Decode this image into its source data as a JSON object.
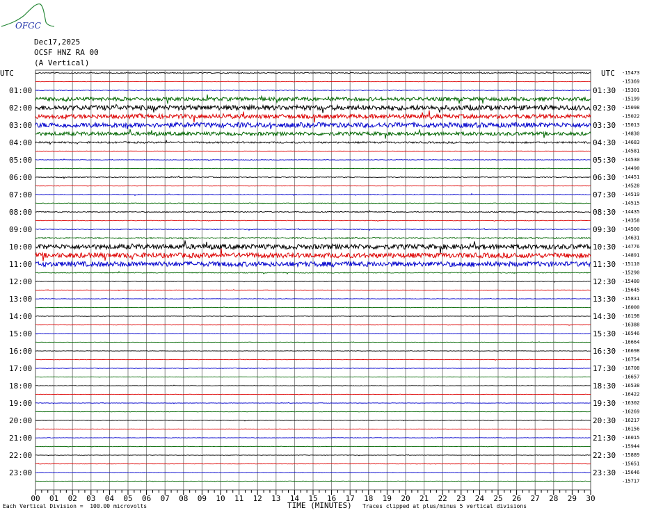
{
  "logo": {
    "text": "OFGC",
    "colors": {
      "mountain": "#2a8a3a",
      "text": "#2233aa"
    }
  },
  "header": {
    "date": "Dec17,2025",
    "station": "OCSF HNZ RA 00",
    "component": "(A Vertical)"
  },
  "axis": {
    "left_title": "UTC",
    "right_title": "UTC",
    "x_title": "TIME (MINUTES)"
  },
  "footer": {
    "left_note": "Each Vertical Division =  100.00 microvolts",
    "right_note": "Traces clipped at plus/minus 5 vertical divisions"
  },
  "chart_data": {
    "type": "line",
    "title": "Dec17,2025 OCSF HNZ RA 00 (A Vertical)",
    "xlabel": "TIME (MINUTES)",
    "xlim": [
      0,
      30
    ],
    "x_ticks": [
      "00",
      "01",
      "02",
      "03",
      "04",
      "05",
      "06",
      "07",
      "08",
      "09",
      "10",
      "11",
      "12",
      "13",
      "14",
      "15",
      "16",
      "17",
      "18",
      "19",
      "20",
      "21",
      "22",
      "23",
      "24",
      "25",
      "26",
      "27",
      "28",
      "29",
      "30"
    ],
    "trace_colors": [
      "#000000",
      "#dd0000",
      "#0000cc",
      "#006600"
    ],
    "grid": true,
    "left_labels": [
      "01:00",
      "02:00",
      "03:00",
      "04:00",
      "05:00",
      "06:00",
      "07:00",
      "08:00",
      "09:00",
      "10:00",
      "11:00",
      "12:00",
      "13:00",
      "14:00",
      "15:00",
      "16:00",
      "17:00",
      "18:00",
      "19:00",
      "20:00",
      "21:00",
      "22:00",
      "23:00"
    ],
    "right_labels": [
      "01:30",
      "02:30",
      "03:30",
      "04:30",
      "05:30",
      "06:30",
      "07:30",
      "08:30",
      "09:30",
      "10:30",
      "11:30",
      "12:30",
      "13:30",
      "14:30",
      "15:30",
      "16:30",
      "17:30",
      "18:30",
      "19:30",
      "20:30",
      "21:30",
      "22:30",
      "23:30"
    ],
    "trace_offsets": [
      -15473,
      -15369,
      -15301,
      -15199,
      -15098,
      -15022,
      -15013,
      -14830,
      -14683,
      -14581,
      -14530,
      -14490,
      -14451,
      -14528,
      -14519,
      -14515,
      -14435,
      -14358,
      -14500,
      -14631,
      -14776,
      -14891,
      -15110,
      -15290,
      -15480,
      -15645,
      -15831,
      -16000,
      -16198,
      -16388,
      -16546,
      -16664,
      -16698,
      -16754,
      -16708,
      -16657,
      -16538,
      -16422,
      -16302,
      -16269,
      -16217,
      -16156,
      -16015,
      -15944,
      -15889,
      -15651,
      -15646,
      -15717
    ],
    "trace_amplitudes": [
      0.6,
      0.3,
      0.5,
      2.5,
      3.5,
      3.0,
      3.5,
      2.5,
      1.2,
      0.3,
      0.4,
      0.3,
      0.6,
      0.3,
      0.5,
      0.5,
      0.6,
      0.4,
      0.5,
      1.0,
      3.5,
      3.5,
      3.5,
      0.6,
      0.4,
      0.3,
      0.3,
      0.3,
      0.3,
      0.3,
      0.3,
      0.3,
      0.3,
      0.3,
      0.3,
      0.3,
      0.3,
      0.3,
      0.3,
      0.3,
      0.3,
      0.3,
      0.3,
      0.3,
      0.3,
      0.3,
      0.3,
      0.3
    ]
  }
}
